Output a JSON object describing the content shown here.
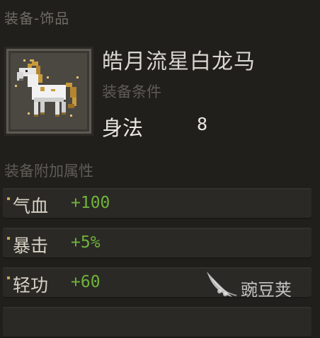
{
  "header": {
    "category": "装备-饰品"
  },
  "item": {
    "name": "皓月流星白龙马",
    "icon": "white-horse-icon",
    "requirement_label": "装备条件",
    "requirement": {
      "stat": "身法",
      "value": "8"
    }
  },
  "bonus_section": {
    "title": "装备附加属性",
    "attributes": [
      {
        "name": "气血",
        "value": "+100"
      },
      {
        "name": "暴击",
        "value": "+5%"
      },
      {
        "name": "轻功",
        "value": "+60"
      }
    ]
  },
  "watermark": {
    "text": "豌豆荚",
    "logo": "wandoujia-pea-pod-logo"
  },
  "colors": {
    "bonus_value": "#6fb33a",
    "background": "#201f1c"
  }
}
